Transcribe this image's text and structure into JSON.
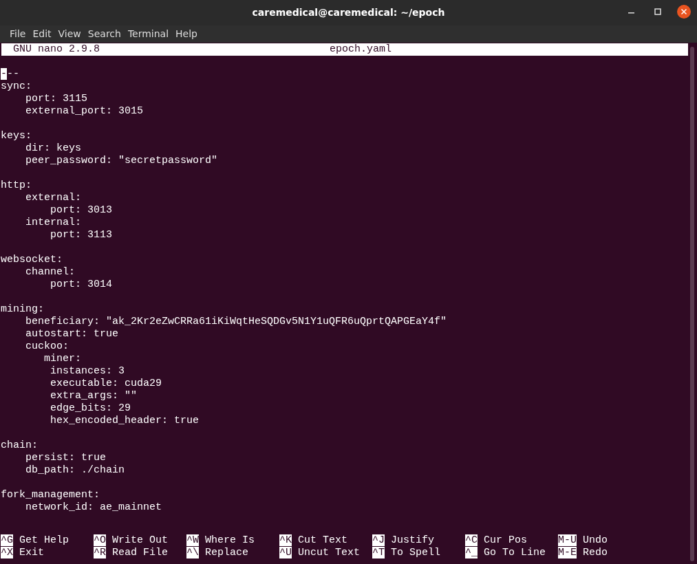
{
  "window": {
    "title": "caremedical@caremedical: ~/epoch"
  },
  "menu": [
    "File",
    "Edit",
    "View",
    "Search",
    "Terminal",
    "Help"
  ],
  "nano_header": {
    "version": "GNU nano 2.9.8",
    "filename": "epoch.yaml"
  },
  "editor": {
    "cursor": true,
    "blocks": [
      [
        "---",
        "sync:",
        "    port: 3115",
        "    external_port: 3015"
      ],
      [
        "keys:",
        "    dir: keys",
        "    peer_password: \"secretpassword\""
      ],
      [
        "http:",
        "    external:",
        "        port: 3013",
        "    internal:",
        "        port: 3113"
      ],
      [
        "websocket:",
        "    channel:",
        "        port: 3014"
      ],
      [
        "mining:",
        "    beneficiary: \"ak_2Kr2eZwCRRa61iKiWqtHeSQDGv5N1Y1uQFR6uQprtQAPGEaY4f\"",
        "    autostart: true",
        "    cuckoo:",
        "       miner:",
        "        instances: 3",
        "        executable: cuda29",
        "        extra_args: \"\"",
        "        edge_bits: 29",
        "        hex_encoded_header: true"
      ],
      [
        "chain:",
        "    persist: true",
        "    db_path: ./chain"
      ],
      [
        "fork_management:",
        "    network_id: ae_mainnet"
      ]
    ]
  },
  "shortcuts": [
    [
      {
        "key": "^G",
        "label": "Get Help"
      },
      {
        "key": "^O",
        "label": "Write Out"
      },
      {
        "key": "^W",
        "label": "Where Is"
      },
      {
        "key": "^K",
        "label": "Cut Text"
      },
      {
        "key": "^J",
        "label": "Justify"
      },
      {
        "key": "^C",
        "label": "Cur Pos"
      },
      {
        "key": "M-U",
        "label": "Undo"
      }
    ],
    [
      {
        "key": "^X",
        "label": "Exit"
      },
      {
        "key": "^R",
        "label": "Read File"
      },
      {
        "key": "^\\",
        "label": "Replace"
      },
      {
        "key": "^U",
        "label": "Uncut Text"
      },
      {
        "key": "^T",
        "label": "To Spell"
      },
      {
        "key": "^_",
        "label": "Go To Line"
      },
      {
        "key": "M-E",
        "label": "Redo"
      }
    ]
  ]
}
